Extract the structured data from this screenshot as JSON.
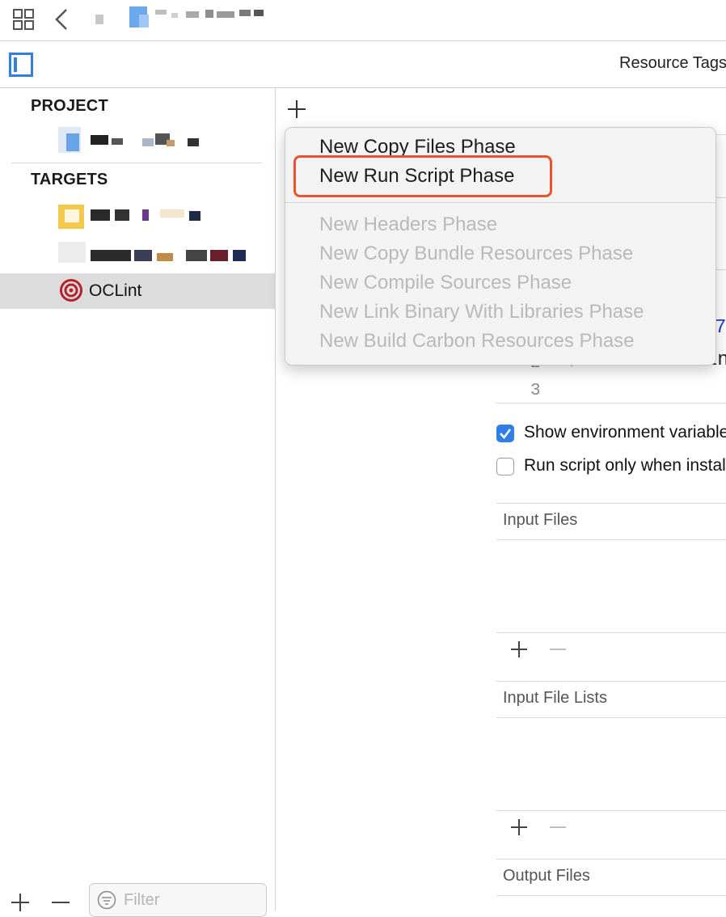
{
  "toolbar": {
    "right_label": "Resource Tags"
  },
  "sidebar": {
    "project_header": "PROJECT",
    "targets_header": "TARGETS",
    "selected_target": "OCLint",
    "filter_placeholder": "Filter"
  },
  "menu": {
    "items_enabled": [
      "New Copy Files Phase",
      "New Run Script Phase"
    ],
    "items_disabled": [
      "New Headers Phase",
      "New Copy Bundle Resources Phase",
      "New Compile Sources Phase",
      "New Link Binary With Libraries Phase",
      "New Build Carbon Resources Phase"
    ]
  },
  "script": {
    "line_numbers": [
      "2",
      "3"
    ],
    "line2_partial": "$SRCROOT/oclint"
  },
  "options": {
    "show_env": "Show environment variables in build log",
    "show_env_checked": true,
    "run_only_install": "Run script only when installing",
    "run_only_install_checked": false
  },
  "sections": {
    "input_files": "Input Files",
    "input_file_lists": "Input File Lists",
    "output_files": "Output Files"
  },
  "colors": {
    "accent": "#2f7fe6",
    "highlight_border": "#e9532e",
    "target_icon": "#b3232c"
  }
}
